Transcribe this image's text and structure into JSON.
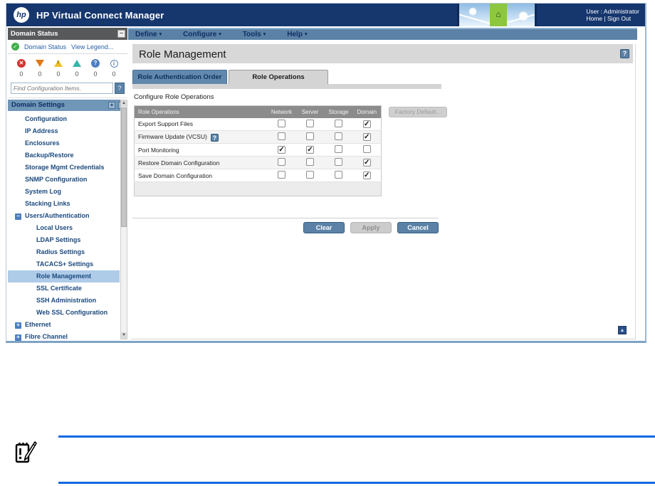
{
  "header": {
    "logo": "hp",
    "title": "HP Virtual Connect Manager",
    "enclosure_glyph": "⌂",
    "user": {
      "label": "User : Administrator",
      "home": "Home",
      "separator": "|",
      "signout": "Sign Out"
    }
  },
  "menubar": {
    "items": [
      {
        "label": "Define"
      },
      {
        "label": "Configure"
      },
      {
        "label": "Tools"
      },
      {
        "label": "Help"
      }
    ],
    "caret": "▾"
  },
  "sidebar": {
    "domain_status": {
      "title": "Domain Status",
      "minimize_glyph": "−",
      "status_link": "Domain Status",
      "legend_link": "View Legend...",
      "icons": [
        {
          "name": "critical-status-icon",
          "shape": "circle",
          "color": "#d23430",
          "glyph": "✕",
          "count": "0"
        },
        {
          "name": "major-status-icon",
          "shape": "tri-down",
          "color": "#e07818",
          "glyph": "",
          "count": "0"
        },
        {
          "name": "minor-status-icon",
          "shape": "tri-up",
          "color": "#edc32a",
          "glyph": "!",
          "count": "0"
        },
        {
          "name": "normal-status-icon",
          "shape": "tri-up",
          "color": "#35b5ab",
          "glyph": "",
          "count": "0"
        },
        {
          "name": "unknown-status-icon",
          "shape": "circle",
          "color": "#4d7fbe",
          "glyph": "?",
          "count": "0"
        },
        {
          "name": "info-status-icon",
          "shape": "circle-outline",
          "color": "#5e87b8",
          "glyph": "i",
          "count": "0"
        }
      ],
      "search_placeholder": "Find Configuration Items.",
      "search_button_glyph": "?"
    },
    "settings": {
      "title": "Domain Settings",
      "expand_all_glyph": "+",
      "collapse_all_glyph": "−",
      "items": [
        {
          "label": "Configuration",
          "type": "item"
        },
        {
          "label": "IP Address",
          "type": "item"
        },
        {
          "label": "Enclosures",
          "type": "item"
        },
        {
          "label": "Backup/Restore",
          "type": "item"
        },
        {
          "label": "Storage Mgmt Credentials",
          "type": "item"
        },
        {
          "label": "SNMP Configuration",
          "type": "item"
        },
        {
          "label": "System Log",
          "type": "item"
        },
        {
          "label": "Stacking Links",
          "type": "item"
        },
        {
          "label": "Users/Authentication",
          "type": "group",
          "toggle_glyph": "−"
        },
        {
          "label": "Local Users",
          "type": "sub"
        },
        {
          "label": "LDAP Settings",
          "type": "sub"
        },
        {
          "label": "Radius Settings",
          "type": "sub"
        },
        {
          "label": "TACACS+ Settings",
          "type": "sub"
        },
        {
          "label": "Role Management",
          "type": "sub",
          "selected": true
        },
        {
          "label": "SSL Certificate",
          "type": "sub"
        },
        {
          "label": "SSH Administration",
          "type": "sub"
        },
        {
          "label": "Web SSL Configuration",
          "type": "sub"
        },
        {
          "label": "Ethernet",
          "type": "group",
          "toggle_glyph": "+"
        },
        {
          "label": "Fibre Channel",
          "type": "group",
          "toggle_glyph": "+"
        }
      ]
    }
  },
  "main": {
    "page_title": "Role Management",
    "help_glyph": "?",
    "tabs": [
      {
        "label": "Role Authentication Order",
        "active": false
      },
      {
        "label": "Role Operations",
        "active": true
      }
    ],
    "section_label": "Configure Role Operations",
    "factory_button": "Factory Default...",
    "table": {
      "headers": [
        "Role Operations",
        "Network",
        "Server",
        "Storage",
        "Domain"
      ],
      "check_glyph": "✓",
      "rows": [
        {
          "label": "Export Support Files",
          "help": false,
          "checks": [
            false,
            false,
            false,
            true
          ]
        },
        {
          "label": "Firmware Update (VCSU)",
          "help": true,
          "checks": [
            false,
            false,
            false,
            true
          ]
        },
        {
          "label": "Port Monitoring",
          "help": false,
          "checks": [
            true,
            true,
            false,
            false
          ]
        },
        {
          "label": "Restore Domain Configuration",
          "help": false,
          "checks": [
            false,
            false,
            false,
            true
          ]
        },
        {
          "label": "Save Domain Configuration",
          "help": false,
          "checks": [
            false,
            false,
            false,
            true
          ]
        }
      ]
    },
    "actions": [
      {
        "label": "Clear",
        "enabled": true
      },
      {
        "label": "Apply",
        "enabled": false
      },
      {
        "label": "Cancel",
        "enabled": true
      }
    ],
    "scroll_top_glyph": "▲"
  },
  "colors": {
    "header_navy": "#16366e",
    "menubar_steel": "#5b82a6",
    "tree_highlight": "#aecbe8",
    "table_header_gray": "#8c8c8c",
    "banner_green": "#8dc63f",
    "note_rule_blue": "#1169e0"
  }
}
